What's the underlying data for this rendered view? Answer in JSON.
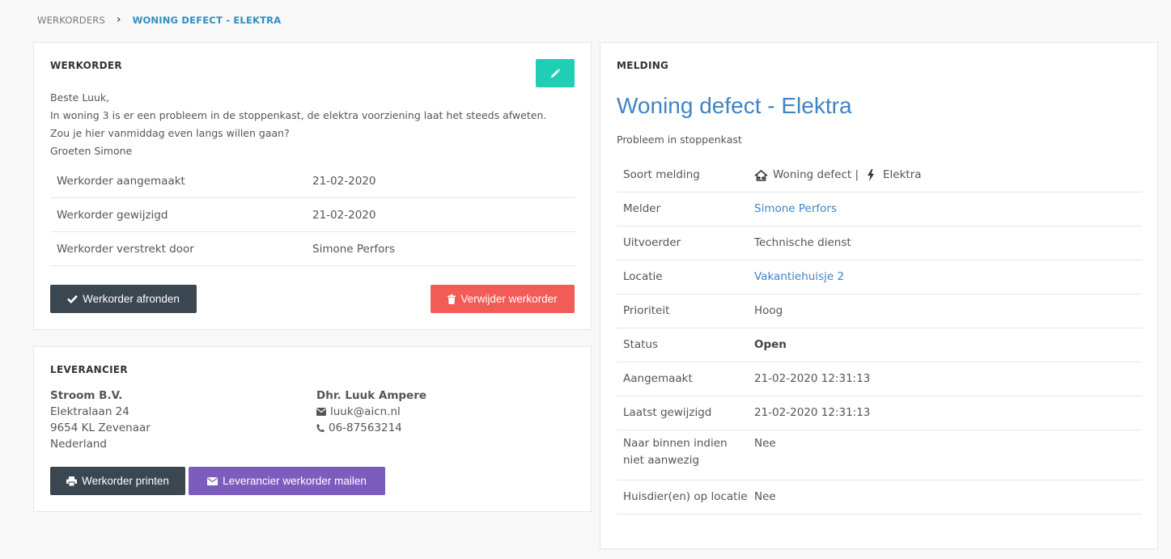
{
  "breadcrumb": {
    "parent": "WERKORDERS",
    "current": "WONING DEFECT - ELEKTRA"
  },
  "werkorder": {
    "title": "WERKORDER",
    "message": [
      "Beste Luuk,",
      "In woning 3 is er een probleem in de stoppenkast, de elektra voorziening laat het steeds afweten.",
      "Zou je hier vanmiddag even langs willen gaan?",
      "Groeten Simone"
    ],
    "rows": [
      {
        "label": "Werkorder aangemaakt",
        "value": "21-02-2020"
      },
      {
        "label": "Werkorder gewijzigd",
        "value": "21-02-2020"
      },
      {
        "label": "Werkorder verstrekt door",
        "value": "Simone Perfors"
      }
    ],
    "btn_afronden": "Werkorder afronden",
    "btn_verwijder": "Verwijder werkorder"
  },
  "leverancier": {
    "title": "LEVERANCIER",
    "company": {
      "name": "Stroom B.V.",
      "street": "Elektralaan 24",
      "city": "9654 KL Zevenaar",
      "country": "Nederland"
    },
    "contact": {
      "name": "Dhr. Luuk Ampere",
      "email": "luuk@aicn.nl",
      "phone": "06-87563214"
    },
    "btn_print": "Werkorder printen",
    "btn_mail": "Leverancier werkorder mailen"
  },
  "melding": {
    "title": "MELDING",
    "heading": "Woning defect - Elektra",
    "subtitle": "Probleem in stoppenkast",
    "soort": {
      "label": "Soort melding",
      "cat1": "Woning defect |",
      "cat2": "Elektra"
    },
    "melder": {
      "label": "Melder",
      "value": "Simone Perfors"
    },
    "uitvoerder": {
      "label": "Uitvoerder",
      "value": "Technische dienst"
    },
    "locatie": {
      "label": "Locatie",
      "value": "Vakantiehuisje 2"
    },
    "prioriteit": {
      "label": "Prioriteit",
      "value": "Hoog"
    },
    "status": {
      "label": "Status",
      "value": "Open"
    },
    "aangemaakt": {
      "label": "Aangemaakt",
      "value": "21-02-2020 12:31:13"
    },
    "gewijzigd": {
      "label": "Laatst gewijzigd",
      "value": "21-02-2020 12:31:13"
    },
    "naar_binnen": {
      "label_1": "Naar binnen indien",
      "label_2": "niet aanwezig",
      "value": "Nee"
    },
    "huisdieren": {
      "label": "Huisdier(en) op locatie",
      "value": "Nee"
    }
  },
  "colors": {
    "accent": "#3f84c4",
    "edit": "#1fcfb5",
    "danger": "#f25c57",
    "dark": "#3a4650",
    "purple": "#7c5cbf"
  }
}
